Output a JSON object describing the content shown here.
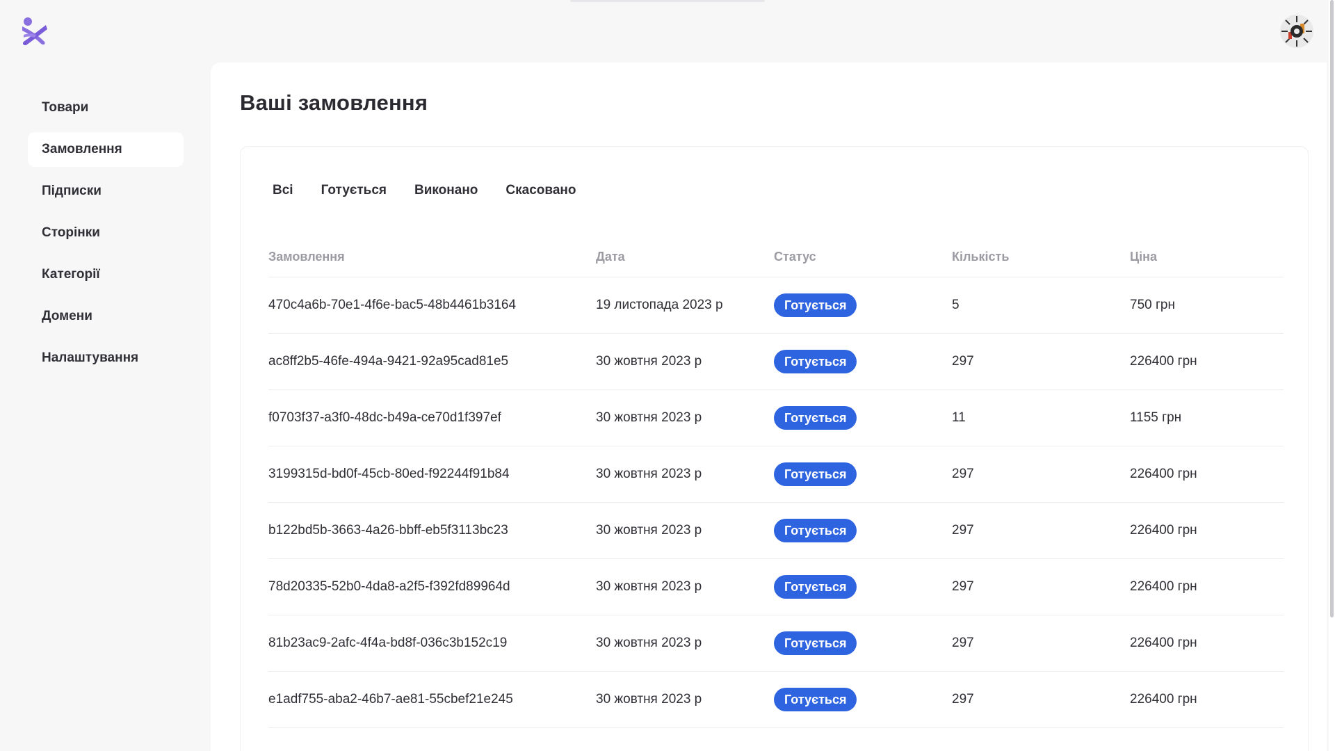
{
  "topbar": {
    "logo_icon": "logo-icon",
    "avatar_icon": "avatar-icon"
  },
  "sidebar": {
    "items": [
      {
        "label": "Товари",
        "active": false
      },
      {
        "label": "Замовлення",
        "active": true
      },
      {
        "label": "Підписки",
        "active": false
      },
      {
        "label": "Сторінки",
        "active": false
      },
      {
        "label": "Категорії",
        "active": false
      },
      {
        "label": "Домени",
        "active": false
      },
      {
        "label": "Налаштування",
        "active": false
      }
    ]
  },
  "main": {
    "title": "Ваші замовлення",
    "tabs": [
      {
        "label": "Всі"
      },
      {
        "label": "Готується"
      },
      {
        "label": "Виконано"
      },
      {
        "label": "Скасовано"
      }
    ],
    "table": {
      "headers": [
        "Замовлення",
        "Дата",
        "Статус",
        "Кількість",
        "Ціна"
      ],
      "rows": [
        {
          "id": "470c4a6b-70e1-4f6e-bac5-48b4461b3164",
          "date": "19 листопада 2023 р",
          "status": "Готується",
          "qty": "5",
          "price": "750 грн"
        },
        {
          "id": "ac8ff2b5-46fe-494a-9421-92a95cad81e5",
          "date": "30 жовтня 2023 р",
          "status": "Готується",
          "qty": "297",
          "price": "226400 грн"
        },
        {
          "id": "f0703f37-a3f0-48dc-b49a-ce70d1f397ef",
          "date": "30 жовтня 2023 р",
          "status": "Готується",
          "qty": "11",
          "price": "1155 грн"
        },
        {
          "id": "3199315d-bd0f-45cb-80ed-f92244f91b84",
          "date": "30 жовтня 2023 р",
          "status": "Готується",
          "qty": "297",
          "price": "226400 грн"
        },
        {
          "id": "b122bd5b-3663-4a26-bbff-eb5f3113bc23",
          "date": "30 жовтня 2023 р",
          "status": "Готується",
          "qty": "297",
          "price": "226400 грн"
        },
        {
          "id": "78d20335-52b0-4da8-a2f5-f392fd89964d",
          "date": "30 жовтня 2023 р",
          "status": "Готується",
          "qty": "297",
          "price": "226400 грн"
        },
        {
          "id": "81b23ac9-2afc-4f4a-bd8f-036c3b152c19",
          "date": "30 жовтня 2023 р",
          "status": "Готується",
          "qty": "297",
          "price": "226400 грн"
        },
        {
          "id": "e1adf755-aba2-46b7-ae81-55cbef21e245",
          "date": "30 жовтня 2023 р",
          "status": "Готується",
          "qty": "297",
          "price": "226400 грн"
        }
      ]
    }
  },
  "colors": {
    "accent": "#2f64e0",
    "logo": "#8a6fe0",
    "background": "#f7f7f8",
    "panel": "#ffffff"
  }
}
